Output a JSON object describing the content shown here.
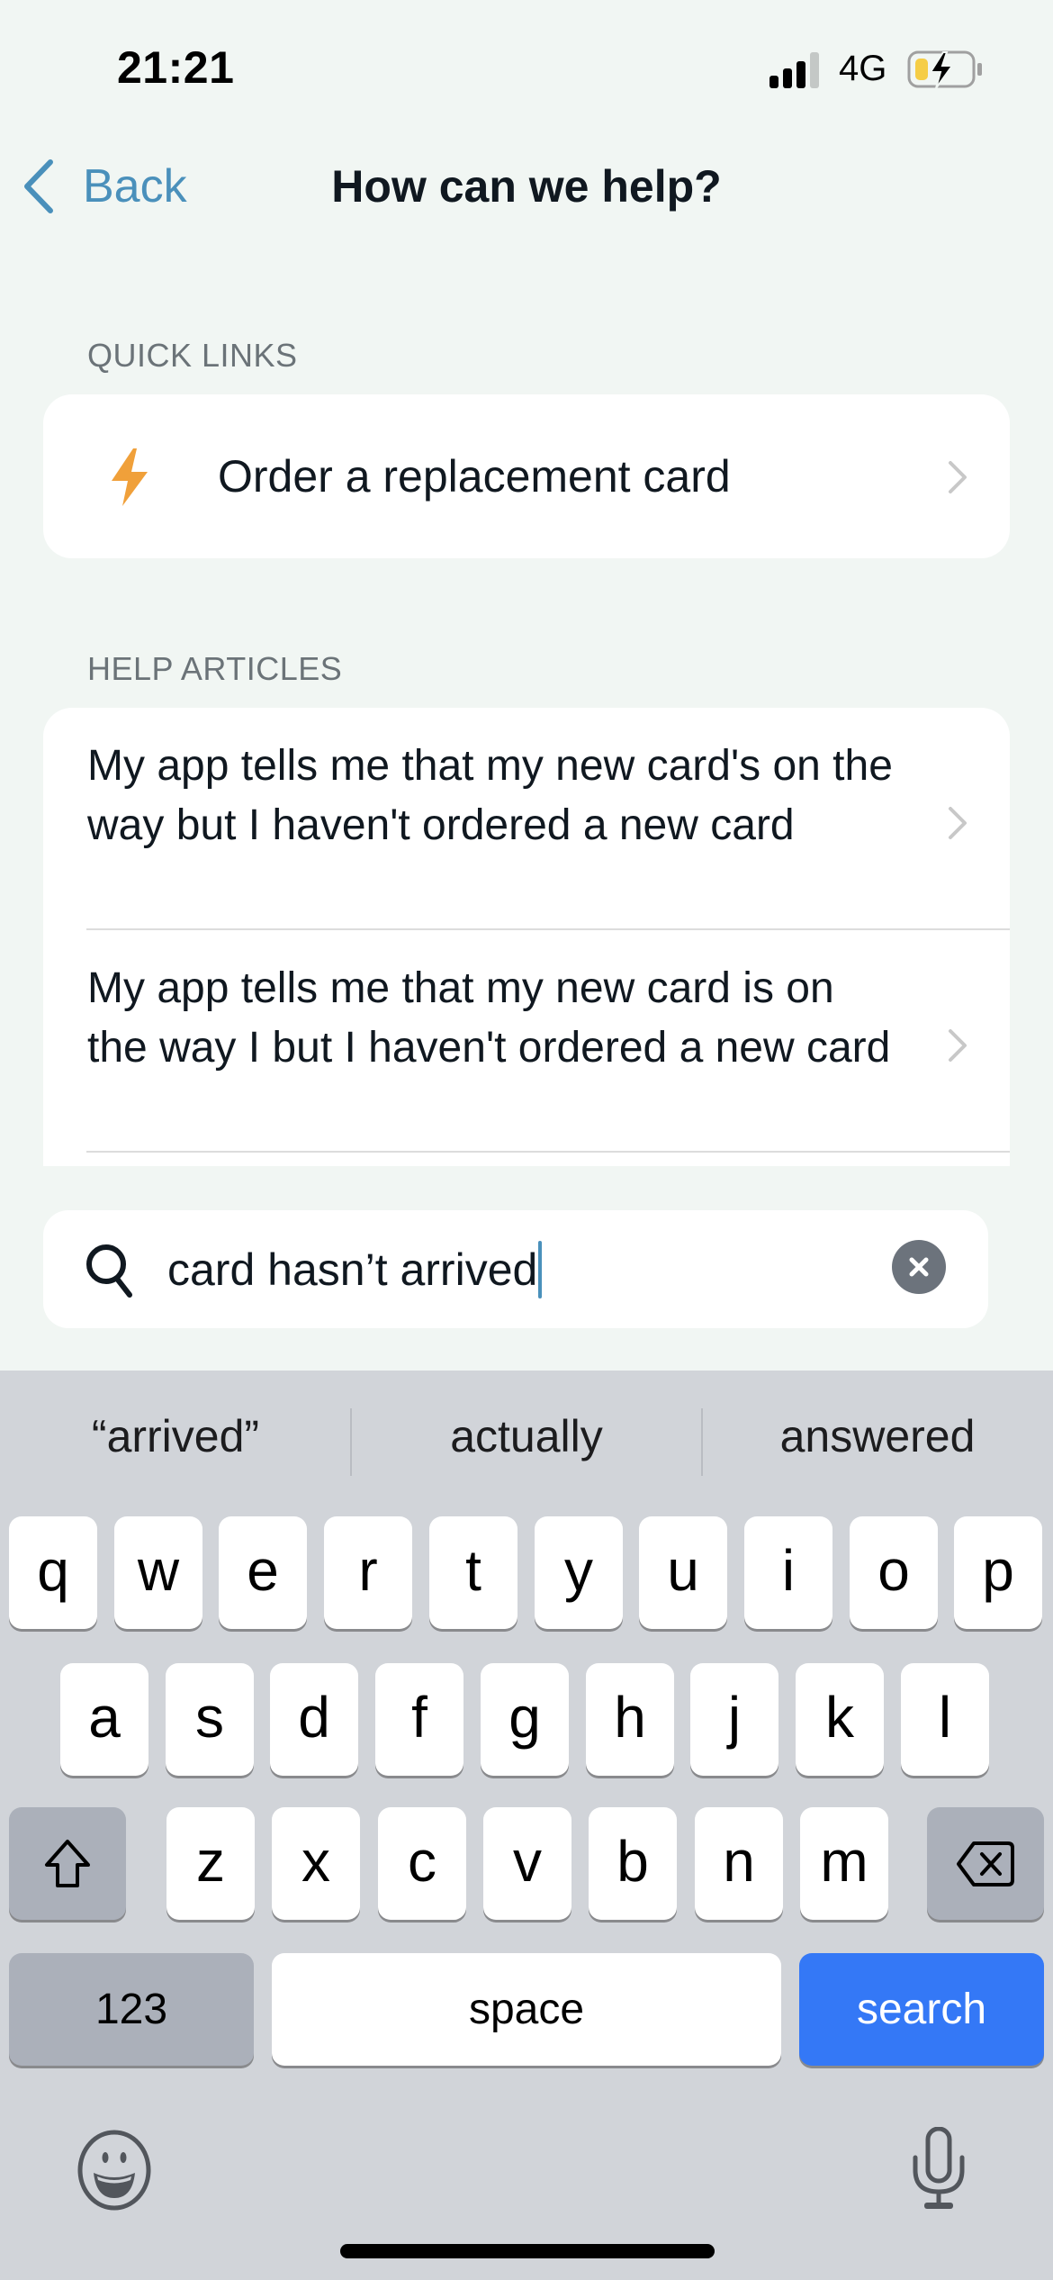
{
  "status_bar": {
    "time": "21:21",
    "network": "4G",
    "signal_bars": 3,
    "signal_bars_total": 4,
    "battery_level": 0.25,
    "battery_charging": true,
    "battery_color": "#F5CD46"
  },
  "nav": {
    "back_label": "Back",
    "title": "How can we help?",
    "accent_color": "#4A90BB"
  },
  "quick_links": {
    "header": "QUICK LINKS",
    "items": [
      {
        "label": "Order a replacement card",
        "icon": "lightning-bolt-icon",
        "icon_color": "#F0A03A"
      }
    ]
  },
  "help_articles": {
    "header": "HELP ARTICLES",
    "items": [
      {
        "label": "My app tells me that my new card's on the way but I haven't ordered a new card"
      },
      {
        "label": "My app tells me that my new card is on the way I but I haven't ordered a new card"
      }
    ]
  },
  "search": {
    "value": "card hasn’t arrived",
    "icon": "search-icon",
    "clear_icon": "clear-icon"
  },
  "keyboard": {
    "suggestions": [
      "“arrived”",
      "actually",
      "answered"
    ],
    "rows": [
      [
        "q",
        "w",
        "e",
        "r",
        "t",
        "y",
        "u",
        "i",
        "o",
        "p"
      ],
      [
        "a",
        "s",
        "d",
        "f",
        "g",
        "h",
        "j",
        "k",
        "l"
      ],
      [
        "z",
        "x",
        "c",
        "v",
        "b",
        "n",
        "m"
      ]
    ],
    "numbers_label": "123",
    "space_label": "space",
    "return_label": "search",
    "return_color": "#3478F6"
  }
}
